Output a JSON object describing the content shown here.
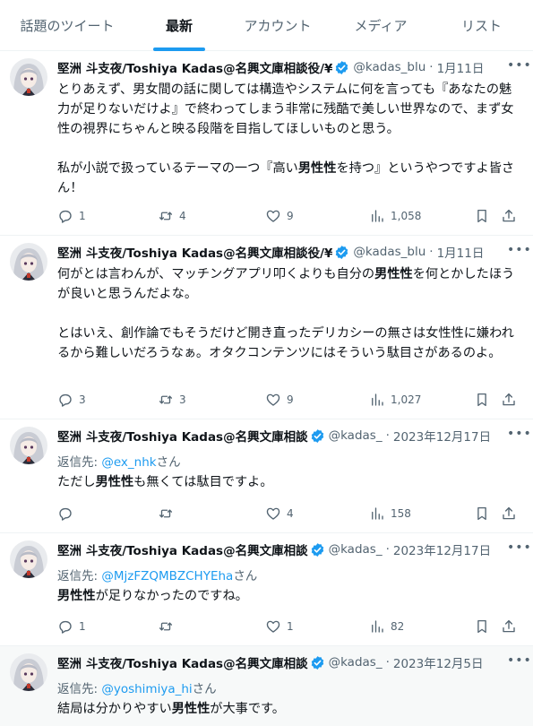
{
  "tabs": [
    {
      "label": "話題のツイート",
      "active": false
    },
    {
      "label": "最新",
      "active": true
    },
    {
      "label": "アカウント",
      "active": false
    },
    {
      "label": "メディア",
      "active": false
    },
    {
      "label": "リスト",
      "active": false
    }
  ],
  "colors": {
    "accent": "#1d9bf0",
    "text": "#0f1419",
    "secondary": "#536471"
  },
  "tweets": [
    {
      "name": "堅洲 斗支夜/Toshiya Kadas@名興文庫相談役/¥",
      "verified": true,
      "handle": "@kadas_blu",
      "date": "1月11日",
      "paragraphs": [
        [
          {
            "t": "とりあえず、男女間の話に関しては構造やシステムに何を言っても『あなたの魅力が足りないだけよ』で終わってしまう非常に残酷で美しい世界なので、まず女性の視界にちゃんと映る段階を目指してほしいものと思う。"
          }
        ],
        [
          {
            "t": "私が小説で扱っているテーマの一つ『高い"
          },
          {
            "t": "男性性",
            "b": true
          },
          {
            "t": "を持つ』というやつですよ皆さん！"
          }
        ]
      ],
      "replies": "1",
      "retweets": "4",
      "likes": "9",
      "views": "1,058"
    },
    {
      "name": "堅洲 斗支夜/Toshiya Kadas@名興文庫相談役/¥",
      "verified": true,
      "handle": "@kadas_blu",
      "date": "1月11日",
      "paragraphs": [
        [
          {
            "t": "何がとは言わんが、マッチングアプリ叩くよりも自分の"
          },
          {
            "t": "男性性",
            "b": true
          },
          {
            "t": "を何とかしたほうが良いと思うんだよな。"
          }
        ],
        [
          {
            "t": "とはいえ、創作論でもそうだけど開き直ったデリカシーの無さは女性性に嫌われるから難しいだろうなぁ。オタクコンテンツにはそういう駄目さがあるのよ。"
          }
        ]
      ],
      "replies": "3",
      "retweets": "3",
      "likes": "9",
      "views": "1,027"
    },
    {
      "name": "堅洲 斗支夜/Toshiya Kadas@名興文庫相談",
      "verified": true,
      "handle": "@kadas_",
      "date": "2023年12月17日",
      "reply_label": "返信先: ",
      "reply_mention": "@ex_nhk",
      "reply_suffix": "さん",
      "paragraphs": [
        [
          {
            "t": "ただし"
          },
          {
            "t": "男性性",
            "b": true
          },
          {
            "t": "も無くては駄目ですよ。"
          }
        ]
      ],
      "replies": "",
      "retweets": "",
      "likes": "4",
      "views": "158"
    },
    {
      "name": "堅洲 斗支夜/Toshiya Kadas@名興文庫相談",
      "verified": true,
      "handle": "@kadas_",
      "date": "2023年12月17日",
      "reply_label": "返信先: ",
      "reply_mention": "@MjzFZQMBZCHYEha",
      "reply_suffix": "さん",
      "paragraphs": [
        [
          {
            "t": "男性性",
            "b": true
          },
          {
            "t": "が足りなかったのですね。"
          }
        ]
      ],
      "replies": "1",
      "retweets": "",
      "likes": "1",
      "views": "82"
    },
    {
      "name": "堅洲 斗支夜/Toshiya Kadas@名興文庫相談",
      "verified": true,
      "handle": "@kadas_",
      "date": "2023年12月5日",
      "reply_label": "返信先: ",
      "reply_mention": "@yoshimiya_hi",
      "reply_suffix": "さん",
      "paragraphs": [
        [
          {
            "t": "結局は分かりやすい"
          },
          {
            "t": "男性性",
            "b": true
          },
          {
            "t": "が大事です。"
          }
        ]
      ]
    }
  ]
}
